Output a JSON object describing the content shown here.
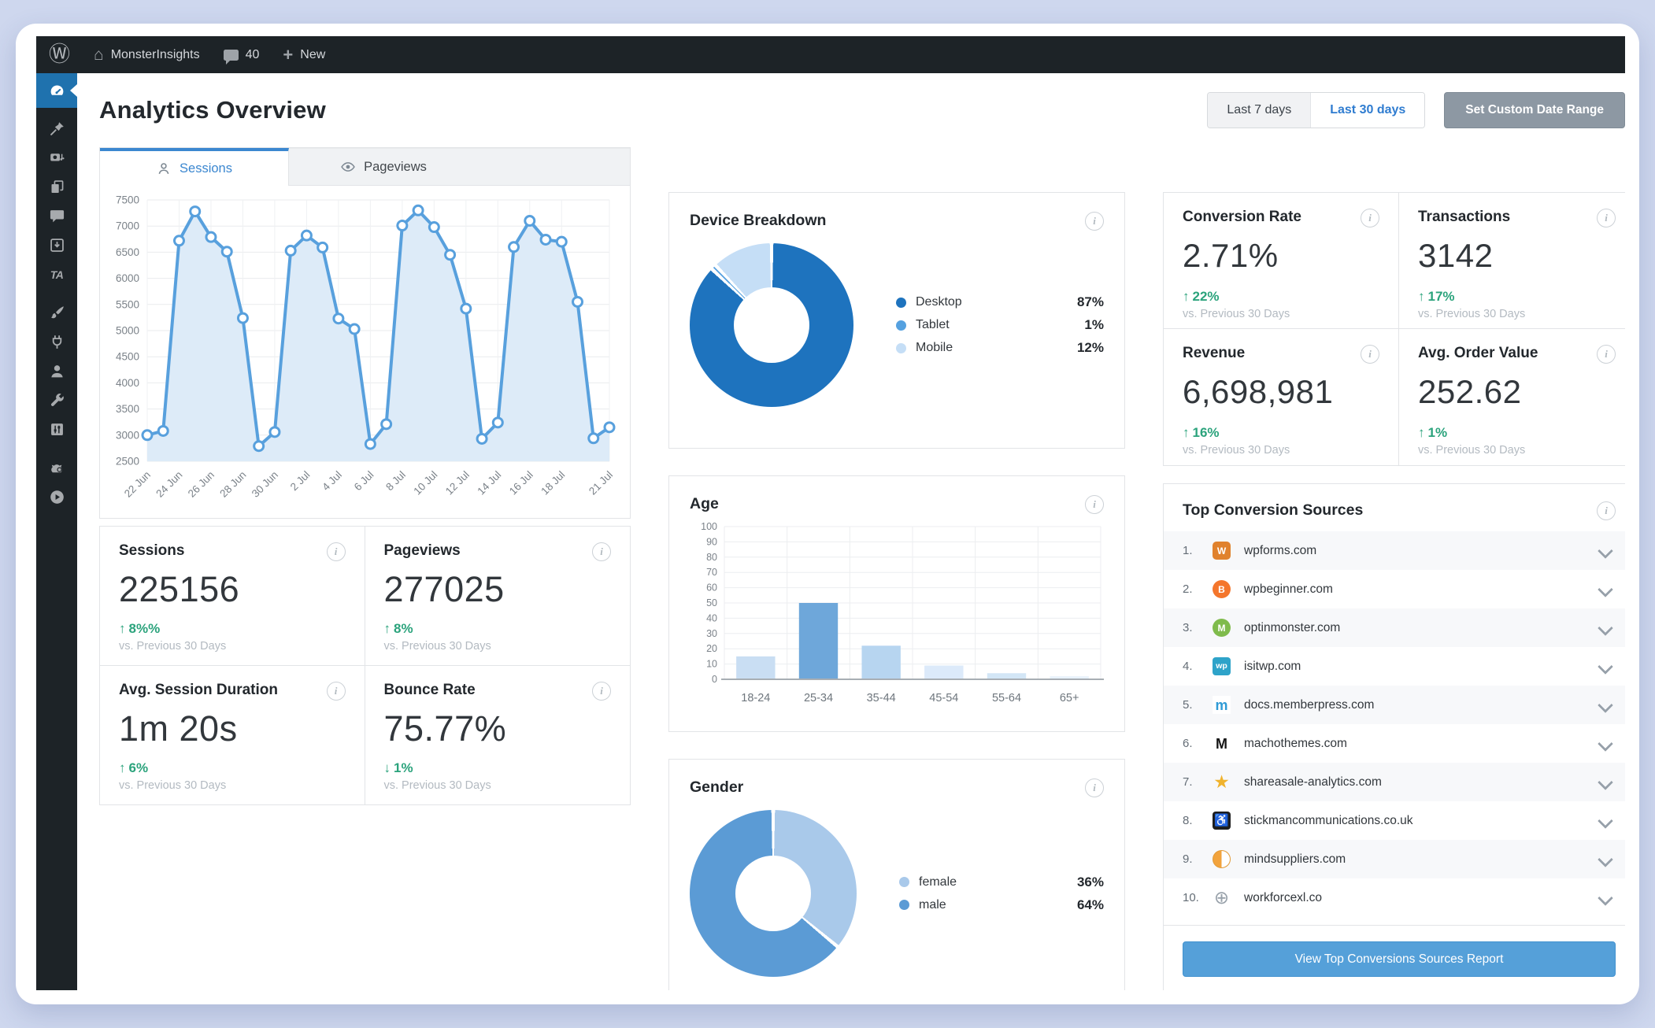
{
  "admin_bar": {
    "site_name": "MonsterInsights",
    "comment_count": "40",
    "new_label": "New"
  },
  "sidebar": {
    "items": [
      {
        "icon": "dashboard-gauge-icon",
        "active": true
      },
      {
        "icon": "pushpin-posts-icon"
      },
      {
        "icon": "media-camera-icon"
      },
      {
        "icon": "pages-stack-icon"
      },
      {
        "icon": "comments-bubble-icon"
      },
      {
        "icon": "download-box-icon"
      },
      {
        "icon": "ta-plugin-icon"
      },
      {
        "icon": "appearance-brush-icon"
      },
      {
        "icon": "plugins-plug-icon"
      },
      {
        "icon": "users-person-icon"
      },
      {
        "icon": "tools-wrench-icon"
      },
      {
        "icon": "settings-sliders-icon"
      },
      {
        "icon": "mascot-monster-icon"
      },
      {
        "icon": "video-play-icon"
      }
    ]
  },
  "page": {
    "title": "Analytics Overview"
  },
  "date_range": {
    "last7": "Last 7 days",
    "last30": "Last 30 days",
    "custom": "Set Custom Date Range"
  },
  "tabs": {
    "sessions": "Sessions",
    "pageviews": "Pageviews"
  },
  "chart_data": [
    {
      "id": "sessions",
      "type": "line",
      "title": "Sessions",
      "ylim": [
        2500,
        7500
      ],
      "ystep": 500,
      "grid": true,
      "line_color": "#58a0dd",
      "fill_color": "#ddebf8",
      "values": [
        3000,
        3080,
        6720,
        7280,
        6790,
        6510,
        5240,
        2790,
        3060,
        6530,
        6820,
        6590,
        5230,
        5030,
        2830,
        3210,
        7010,
        7300,
        6980,
        6450,
        5420,
        2930,
        3240,
        6600,
        7100,
        6740,
        6700,
        5550,
        2940,
        3150
      ],
      "x_ticks": [
        {
          "i": 0,
          "label": "22 Jun"
        },
        {
          "i": 2,
          "label": "24 Jun"
        },
        {
          "i": 4,
          "label": "26 Jun"
        },
        {
          "i": 6,
          "label": "28 Jun"
        },
        {
          "i": 8,
          "label": "30 Jun"
        },
        {
          "i": 10,
          "label": "2 Jul"
        },
        {
          "i": 12,
          "label": "4 Jul"
        },
        {
          "i": 14,
          "label": "6 Jul"
        },
        {
          "i": 16,
          "label": "8 Jul"
        },
        {
          "i": 18,
          "label": "10 Jul"
        },
        {
          "i": 20,
          "label": "12 Jul"
        },
        {
          "i": 22,
          "label": "14 Jul"
        },
        {
          "i": 24,
          "label": "16 Jul"
        },
        {
          "i": 26,
          "label": "18 Jul"
        },
        {
          "i": 29,
          "label": "21 Jul"
        }
      ]
    },
    {
      "id": "device",
      "type": "pie",
      "title": "Device Breakdown",
      "legend_position": "right",
      "slices": [
        {
          "label": "Desktop",
          "value": 87,
          "display": "87%",
          "color": "#1e73be"
        },
        {
          "label": "Tablet",
          "value": 1,
          "display": "1%",
          "color": "#55a1e0"
        },
        {
          "label": "Mobile",
          "value": 12,
          "display": "12%",
          "color": "#c5def6"
        }
      ]
    },
    {
      "id": "age",
      "type": "bar",
      "title": "Age",
      "categories": [
        "18-24",
        "25-34",
        "35-44",
        "45-54",
        "55-64",
        "65+"
      ],
      "values": [
        15,
        50,
        22,
        9,
        4,
        2
      ],
      "colors": [
        "#c9def3",
        "#6ea7da",
        "#b7d5f0",
        "#dceafa",
        "#d3e6f6",
        "#e9f2fb"
      ],
      "ylim": [
        0,
        100
      ],
      "ystep": 10,
      "grid": true
    },
    {
      "id": "gender",
      "type": "pie",
      "title": "Gender",
      "legend_position": "right",
      "slices": [
        {
          "label": "female",
          "value": 36,
          "display": "36%",
          "color": "#a9c9ea"
        },
        {
          "label": "male",
          "value": 64,
          "display": "64%",
          "color": "#5b9bd5"
        }
      ]
    }
  ],
  "stats": {
    "left": [
      {
        "title": "Sessions",
        "value": "225156",
        "arrow": "↑",
        "change": "8%%",
        "sub": "vs. Previous 30 Days"
      },
      {
        "title": "Pageviews",
        "value": "277025",
        "arrow": "↑",
        "change": "8%",
        "sub": "vs. Previous 30 Days"
      },
      {
        "title": "Avg. Session Duration",
        "value": "1m 20s",
        "arrow": "↑",
        "change": "6%",
        "sub": "vs. Previous 30 Days"
      },
      {
        "title": "Bounce Rate",
        "value": "75.77%",
        "arrow": "↓",
        "change": "1%",
        "sub": "vs. Previous 30 Days"
      }
    ],
    "right": [
      {
        "title": "Conversion Rate",
        "value": "2.71%",
        "arrow": "↑",
        "change": "22%",
        "sub": "vs. Previous 30 Days"
      },
      {
        "title": "Transactions",
        "value": "3142",
        "arrow": "↑",
        "change": "17%",
        "sub": "vs. Previous 30 Days"
      },
      {
        "title": "Revenue",
        "value": "6,698,981",
        "arrow": "↑",
        "change": "16%",
        "sub": "vs. Previous 30 Days"
      },
      {
        "title": "Avg. Order Value",
        "value": "252.62",
        "arrow": "↑",
        "change": "1%",
        "sub": "vs. Previous 30 Days"
      }
    ],
    "change_color": "#2ba37c"
  },
  "sources": {
    "title": "Top Conversion Sources",
    "button": "View Top Conversions Sources Report",
    "items": [
      {
        "rank": "1.",
        "domain": "wpforms.com",
        "icon": "wpforms-favicon",
        "char": "W",
        "icon_style": "background:#e0822d;color:#fff;border-radius:5px;font-weight:bold"
      },
      {
        "rank": "2.",
        "domain": "wpbeginner.com",
        "icon": "wpbeginner-favicon",
        "char": "B",
        "icon_style": "background:#f4762c;color:#fff;border-radius:50%;font-weight:bold"
      },
      {
        "rank": "3.",
        "domain": "optinmonster.com",
        "icon": "optinmonster-favicon",
        "char": "M",
        "icon_style": "background:#7fbb4c;color:#fff;border-radius:50%;font-weight:bold"
      },
      {
        "rank": "4.",
        "domain": "isitwp.com",
        "icon": "isitwp-favicon",
        "char": "wp",
        "icon_style": "background:#2ea3c9;color:#fff;border-radius:4px;font-weight:bold;font-size:10.5px"
      },
      {
        "rank": "5.",
        "domain": "docs.memberpress.com",
        "icon": "memberpress-favicon",
        "char": "m",
        "icon_style": "background:#fff;color:#2f9bd6;font-weight:bold;font-size:18px"
      },
      {
        "rank": "6.",
        "domain": "machothemes.com",
        "icon": "machothemes-favicon",
        "char": "M",
        "icon_style": "background:#fff;color:#141414;font-weight:bold;font-size:18px"
      },
      {
        "rank": "7.",
        "domain": "shareasale-analytics.com",
        "icon": "star-favicon",
        "char": "★",
        "icon_style": "background:transparent;color:#f0b32e;font-size:23px"
      },
      {
        "rank": "8.",
        "domain": "stickmancommunications.co.uk",
        "icon": "stickman-favicon",
        "char": "♿",
        "icon_style": "background:#1e1e1e;color:#fff;border-radius:4px;font-size:15px"
      },
      {
        "rank": "9.",
        "domain": "mindsuppliers.com",
        "icon": "split-circle-favicon",
        "char": "",
        "icon_style": "background:linear-gradient(90deg,#f2a33c 50%,#fff 50%);border:1.5px solid #e29a36;border-radius:50%"
      },
      {
        "rank": "10.",
        "domain": "workforcexl.co",
        "icon": "globe-favicon",
        "char": "⊕",
        "icon_style": "background:transparent;color:#98a1aa;font-size:23px"
      }
    ]
  }
}
